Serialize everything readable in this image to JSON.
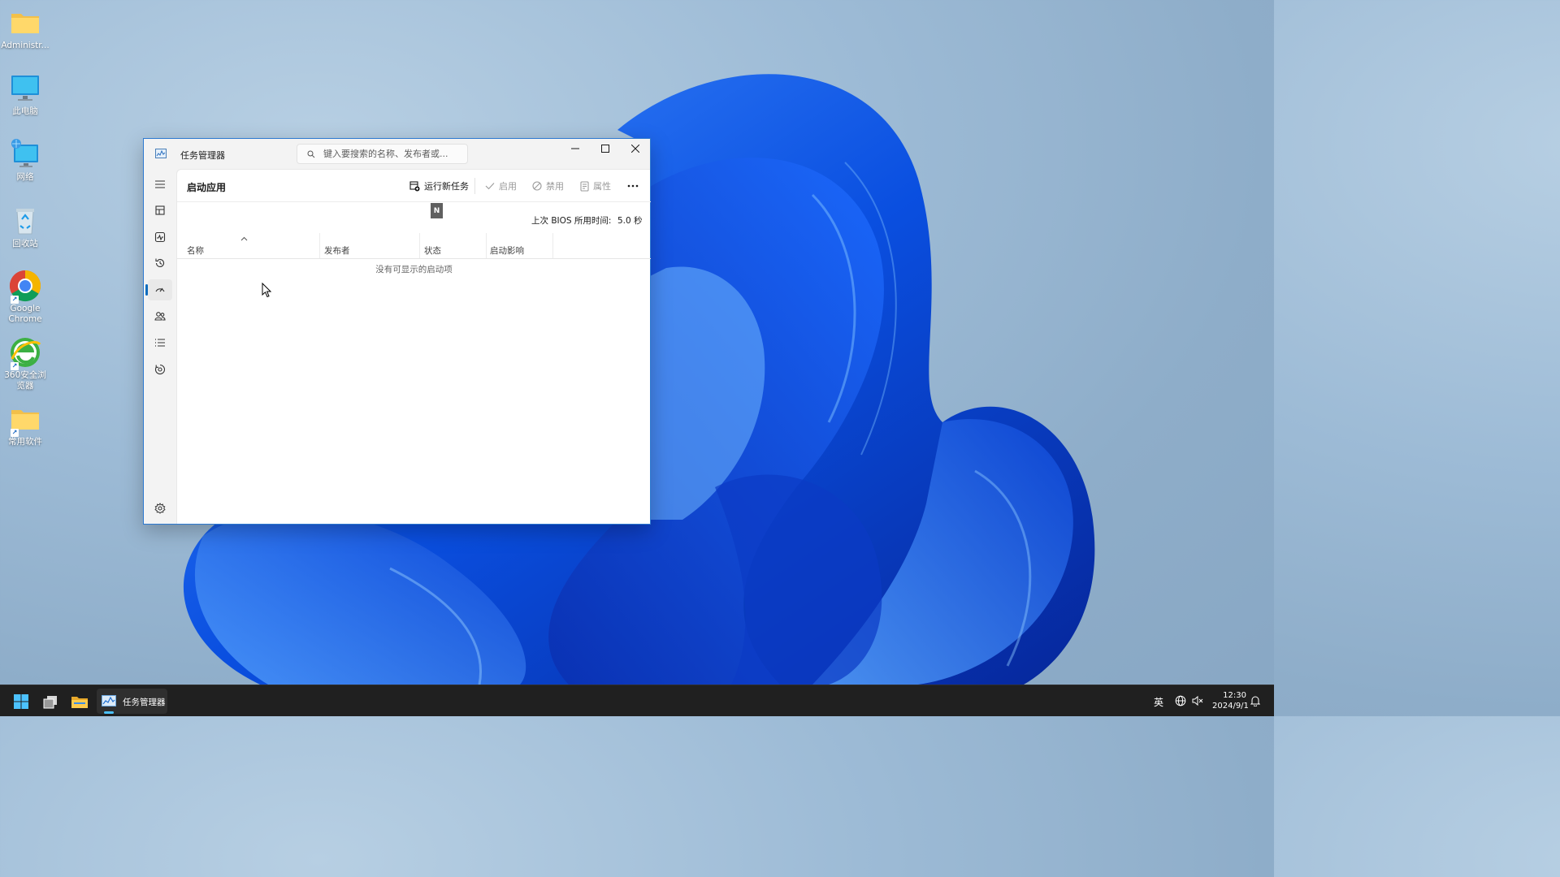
{
  "desktop": {
    "icons": [
      {
        "label": "Administr...",
        "icon": "folder-icon"
      },
      {
        "label": "此电脑",
        "icon": "computer-icon"
      },
      {
        "label": "网络",
        "icon": "network-icon"
      },
      {
        "label": "回收站",
        "icon": "recycle-bin-icon"
      },
      {
        "label": "Google Chrome",
        "icon": "chrome-icon"
      },
      {
        "label": "360安全浏览器",
        "icon": "browser-360-icon"
      },
      {
        "label": "常用软件",
        "icon": "folder-icon"
      }
    ]
  },
  "window": {
    "title": "任务管理器",
    "search": {
      "placeholder": "键入要搜索的名称、发布者或..."
    },
    "controls": {
      "minimize": "minimize-icon",
      "maximize": "maximize-icon",
      "close": "close-icon"
    },
    "nav": [
      {
        "name": "hamburger-menu",
        "icon": "hamburger-icon"
      },
      {
        "name": "processes",
        "icon": "processes-icon"
      },
      {
        "name": "performance",
        "icon": "performance-icon"
      },
      {
        "name": "app-history",
        "icon": "history-icon"
      },
      {
        "name": "startup-apps",
        "icon": "startup-icon",
        "active": true
      },
      {
        "name": "users",
        "icon": "users-icon"
      },
      {
        "name": "details",
        "icon": "details-icon"
      },
      {
        "name": "services",
        "icon": "services-icon"
      },
      {
        "name": "settings",
        "icon": "gear-icon"
      }
    ],
    "page": {
      "title": "启动应用",
      "toolbar": {
        "run_new_task": "运行新任务",
        "enable": "启用",
        "disable": "禁用",
        "properties": "属性"
      },
      "keyboard_hint": "N",
      "bios_label": "上次 BIOS 所用时间:",
      "bios_value": "5.0 秒",
      "columns": [
        "名称",
        "发布者",
        "状态",
        "启动影响"
      ],
      "empty_message": "没有可显示的启动项"
    }
  },
  "taskbar": {
    "task_manager_label": "任务管理器",
    "ime": "英",
    "time": "12:30",
    "date": "2024/9/1"
  },
  "colors": {
    "accent": "#0f6cbd",
    "window_border": "#2d79d0",
    "taskbar": "#202020"
  }
}
